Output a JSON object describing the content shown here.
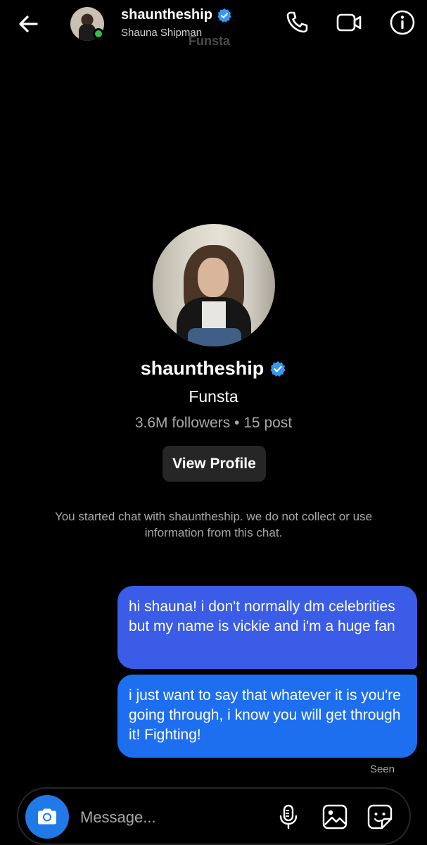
{
  "header": {
    "username": "shauntheship",
    "display_name": "Shauna Shipman",
    "overlay_text": "Funsta",
    "icons": [
      "back-arrow-icon",
      "phone-icon",
      "video-camera-icon",
      "info-icon"
    ]
  },
  "profile": {
    "username": "shauntheship",
    "name": "Funsta",
    "stats": "3.6M followers • 15 post",
    "view_button": "View Profile",
    "verified": true
  },
  "system_message": "You started chat with shauntheship. we do not collect or use information from this chat.",
  "messages": [
    {
      "text": "hi shauna! i don't normally dm celebrities but my name is vickie and i'm a huge fan",
      "from": "me"
    },
    {
      "text": "i just want to say that whatever it is you're going through, i know you will get through it! Fighting!",
      "from": "me"
    }
  ],
  "status": "Seen",
  "composer": {
    "placeholder": "Message...",
    "icons": [
      "camera-icon",
      "microphone-icon",
      "gallery-icon",
      "sticker-icon"
    ]
  },
  "colors": {
    "background": "#000000",
    "bubble_top": "#3a5ce6",
    "bubble_bottom": "#1e6ff0",
    "verified": "#3897f0",
    "online": "#2fbf4a"
  }
}
